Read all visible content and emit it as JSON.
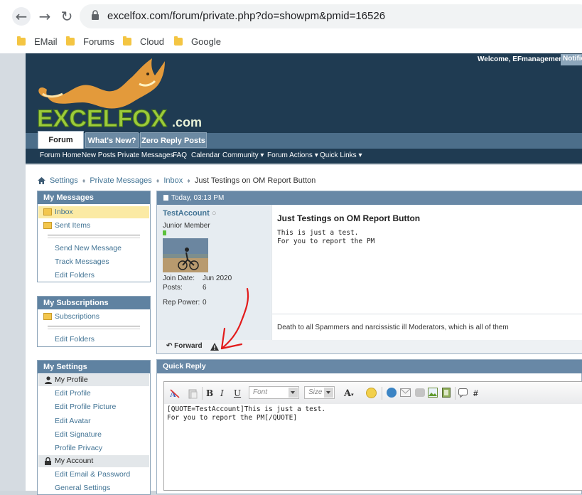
{
  "browser": {
    "url": "excelfox.com/forum/private.php?do=showpm&pmid=16526",
    "bookmarks": [
      "EMail",
      "Forums",
      "Cloud",
      "Google"
    ]
  },
  "header": {
    "welcome": "Welcome,  EFmanagement",
    "notifications": "Notific",
    "logo_text": "EXCELFOX",
    "logo_suffix": ".com"
  },
  "nav": {
    "tabs": [
      "Forum",
      "What's New?",
      "Zero Reply Posts"
    ],
    "sublinks": [
      "Forum Home",
      "New Posts",
      "Private Messages",
      "FAQ",
      "Calendar",
      "Community",
      "Forum Actions",
      "Quick Links"
    ]
  },
  "breadcrumb": [
    "Settings",
    "Private Messages",
    "Inbox",
    "Just Testings on OM Report Button"
  ],
  "sidebar": {
    "messages": {
      "title": "My Messages",
      "items": [
        "Inbox",
        "Sent Items",
        "Send New Message",
        "Track Messages",
        "Edit Folders"
      ]
    },
    "subscriptions": {
      "title": "My Subscriptions",
      "items": [
        "Subscriptions",
        "Edit Folders"
      ]
    },
    "settings": {
      "title": "My Settings",
      "profile_header": "My Profile",
      "profile_items": [
        "Edit Profile",
        "Edit Profile Picture",
        "Edit Avatar",
        "Edit Signature",
        "Profile Privacy"
      ],
      "account_header": "My Account",
      "account_items": [
        "Edit Email & Password",
        "General Settings"
      ]
    }
  },
  "message": {
    "date": "Today, 03:13 PM",
    "username": "TestAccount",
    "usertitle": "Junior Member",
    "join_label": "Join Date:",
    "join_value": "Jun 2020",
    "posts_label": "Posts:",
    "posts_value": "6",
    "rep_label": "Rep Power:",
    "rep_value": "0",
    "title": "Just Testings on OM Report Button",
    "body_line1": "This is just a test.",
    "body_line2": "For you to report the PM",
    "signature": "Death to all Spammers and narcissistic ill Moderators, which is all of them",
    "forward_label": "Forward"
  },
  "quick_reply": {
    "title": "Quick Reply",
    "font_placeholder": "Font",
    "size_placeholder": "Size",
    "text_line1": "[QUOTE=TestAccount]This is just a test.",
    "text_line2": "For you to report the PM[/QUOTE]"
  }
}
